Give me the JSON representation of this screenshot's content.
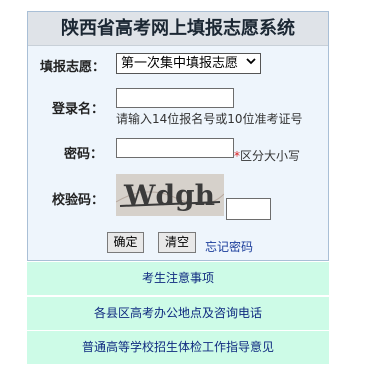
{
  "title": "陕西省高考网上填报志愿系统",
  "form": {
    "volunteer_label": "填报志愿：",
    "volunteer_selected": "第一次集中填报志愿",
    "login_label": "登录名：",
    "login_value": "",
    "login_hint": "请输入14位报名号或10位准考证号",
    "password_label": "密码：",
    "password_value": "",
    "password_hint": "区分大小写",
    "password_star": "*",
    "captcha_label": "校验码：",
    "captcha_value": "",
    "captcha_text": "Wdgh",
    "confirm_label": "确定",
    "clear_label": "清空",
    "forgot_label": "忘记密码"
  },
  "nav": {
    "item1": "考生注意事项",
    "item2": "各县区高考办公地点及咨询电话",
    "item3": "普通高等学校招生体检工作指导意见"
  }
}
